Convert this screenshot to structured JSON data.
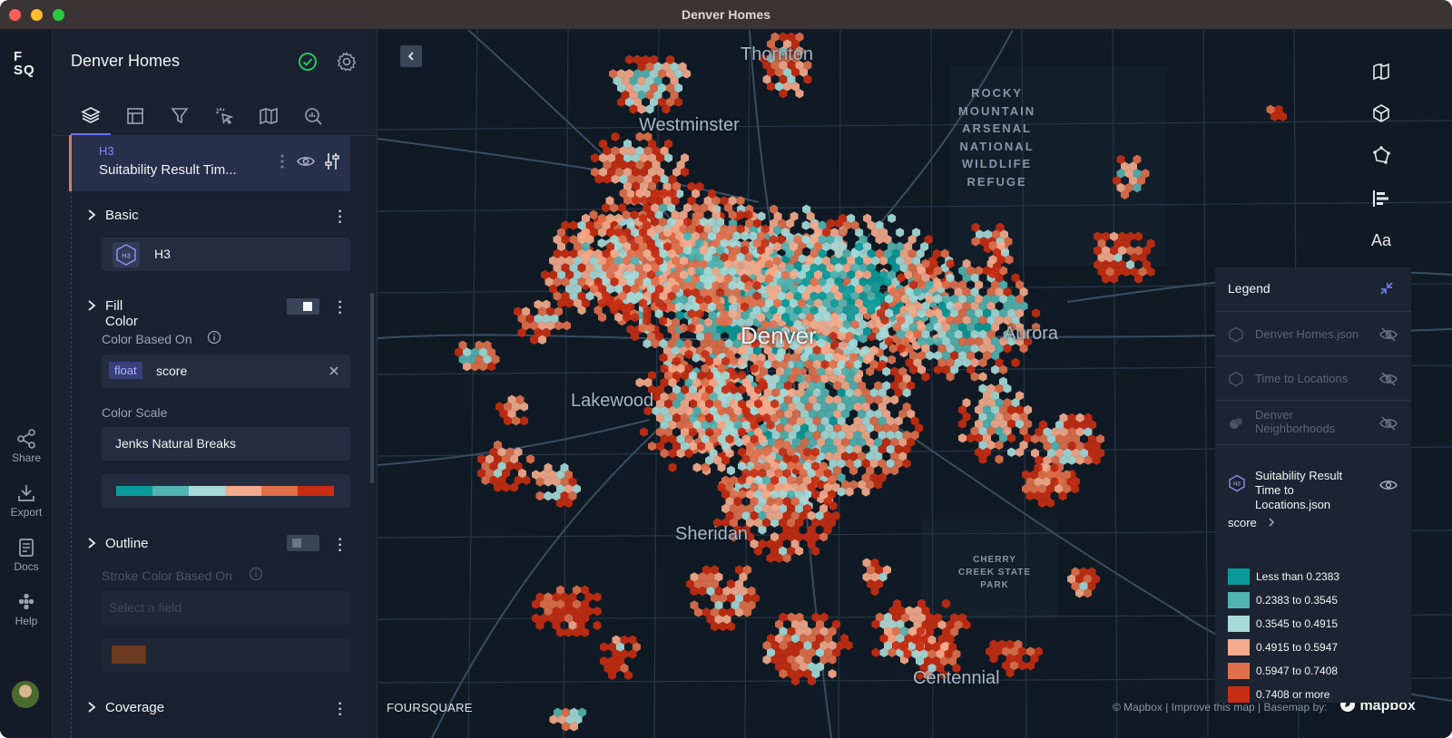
{
  "window": {
    "title": "Denver Homes"
  },
  "rail": {
    "logo_line1": "F",
    "logo_line2": "SQ",
    "buttons": [
      {
        "label": "Share",
        "icon": "share-icon"
      },
      {
        "label": "Export",
        "icon": "export-icon"
      },
      {
        "label": "Docs",
        "icon": "docs-icon"
      },
      {
        "label": "Help",
        "icon": "help-icon"
      }
    ]
  },
  "panel": {
    "title": "Denver Homes",
    "tabs": [
      "layers-icon",
      "table-icon",
      "filter-icon",
      "interactions-icon",
      "basemap-icon",
      "analysis-icon"
    ],
    "layer": {
      "type": "H3",
      "name": "Suitability Result Tim..."
    },
    "basic": {
      "label": "Basic",
      "layer_type": "H3"
    },
    "fill_color": {
      "label": "Fill Color",
      "color_based_on_label": "Color Based On",
      "field_type": "float",
      "field_name": "score",
      "color_scale_label": "Color Scale",
      "color_scale": "Jenks Natural Breaks",
      "palette": [
        "#0b9a9a",
        "#53b3b0",
        "#a5dad8",
        "#f4aa8c",
        "#e0704c",
        "#c62d12"
      ]
    },
    "outline": {
      "label": "Outline",
      "stroke_color_based_on_label": "Stroke Color Based On",
      "field_placeholder": "Select a field",
      "stroke_color": "#6b3a1f"
    },
    "coverage": {
      "label": "Coverage"
    }
  },
  "map": {
    "places": {
      "thornton": "Thornton",
      "westminster": "Westminster",
      "denver": "Denver",
      "aurora": "Aurora",
      "lakewood": "Lakewood",
      "sheridan": "Sheridan",
      "centennial": "Centennial"
    },
    "refuge_lines": [
      "ROCKY",
      "MOUNTAIN",
      "ARSENAL",
      "NATIONAL",
      "WILDLIFE",
      "REFUGE"
    ],
    "cherry_lines": [
      "CHERRY",
      "CREEK STATE",
      "PARK"
    ],
    "watermark": "FOURSQUARE",
    "attribution": "© Mapbox | Improve this map | Basemap by:",
    "mapbox_logo": "mapbox",
    "tools": [
      "split-map-icon",
      "3d-cube-icon",
      "draw-polygon-icon",
      "legend-icon",
      "text-labels-icon"
    ],
    "text_tool_label": "Aa"
  },
  "legend": {
    "title": "Legend",
    "layers": [
      {
        "name": "Denver Homes.json",
        "visible": false
      },
      {
        "name": "Time to Locations",
        "visible": false
      },
      {
        "name": "Denver Neighborhoods",
        "visible": false
      }
    ],
    "active_layer": "Suitability Result Time to Locations.json",
    "field": "score",
    "items": [
      {
        "label": "Less than 0.2383",
        "color": "#0b9a9a"
      },
      {
        "label": "0.2383 to 0.3545",
        "color": "#53b3b0"
      },
      {
        "label": "0.3545 to 0.4915",
        "color": "#a5dad8"
      },
      {
        "label": "0.4915 to 0.5947",
        "color": "#f4aa8c"
      },
      {
        "label": "0.5947 to 0.7408",
        "color": "#e0704c"
      },
      {
        "label": "0.7408 or more",
        "color": "#c62d12"
      }
    ]
  }
}
